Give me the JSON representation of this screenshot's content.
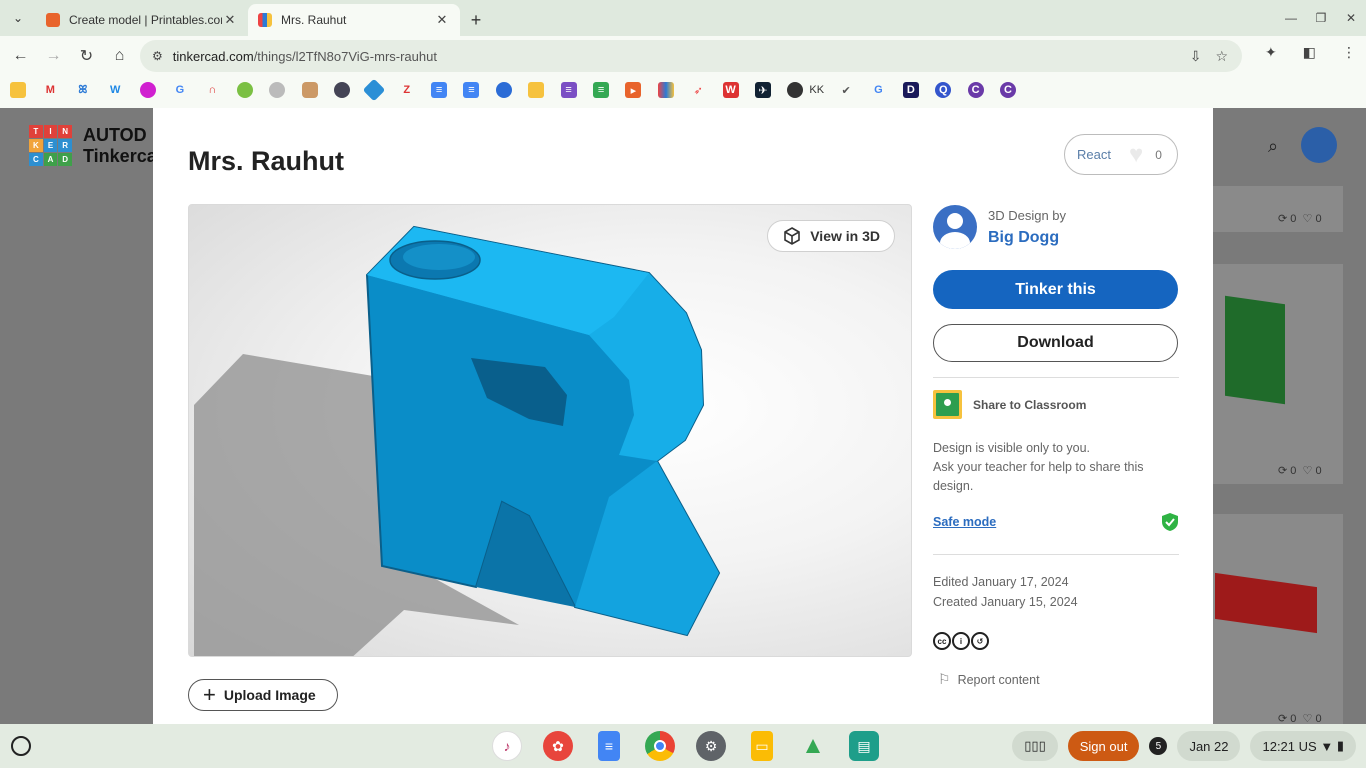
{
  "browser": {
    "tabs": [
      {
        "title": "Create model | Printables.com",
        "active": false,
        "favicon_color": "#e8642c"
      },
      {
        "title": "Mrs. Rauhut",
        "active": true,
        "favicon_color": "#2c7ad6"
      }
    ],
    "url_host": "tinkercad.com",
    "url_path": "/things/l2TfN8o7ViG-mrs-rauhut",
    "bookmark_kk_label": "KK"
  },
  "background_page": {
    "brand_line1": "AUTOD",
    "brand_line2": "Tinkercad",
    "logo_letters": [
      "T",
      "I",
      "N",
      "K",
      "E",
      "R",
      "C",
      "A",
      "D"
    ],
    "card_stats": [
      {
        "remix": "0",
        "likes": "0"
      },
      {
        "remix": "0",
        "likes": "0"
      },
      {
        "remix": "0",
        "likes": "0"
      }
    ]
  },
  "design": {
    "title": "Mrs. Rauhut",
    "react_label": "React",
    "react_count": "0",
    "view3d_label": "View in 3D",
    "upload_label": "Upload Image",
    "author_prefix": "3D Design by",
    "author_name": "Big Dogg",
    "tinker_label": "Tinker this",
    "download_label": "Download",
    "share_label": "Share to Classroom",
    "visibility_note_1": "Design is visible only to you.",
    "visibility_note_2": "Ask your teacher for help to share this design.",
    "safe_mode_label": "Safe mode",
    "edited": "Edited January 17, 2024",
    "created": "Created January 15, 2024",
    "report_label": "Report content",
    "accent_color": "#1565c0",
    "model_color": "#10a0e0"
  },
  "shelf": {
    "sign_out_label": "Sign out",
    "notification_count": "5",
    "date": "Jan 22",
    "time": "12:21",
    "locale": "US"
  }
}
